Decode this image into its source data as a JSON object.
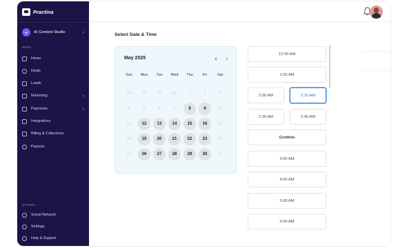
{
  "brand": {
    "name": "Practina"
  },
  "sidebar": {
    "studio": {
      "label": "AI Content Studio"
    },
    "menu_label": "MENU",
    "items": [
      {
        "label": "Home",
        "icon": "home-icon",
        "has_arrow": false
      },
      {
        "label": "Deals",
        "icon": "deals-icon",
        "has_arrow": false
      },
      {
        "label": "Leads",
        "icon": "funnel-icon",
        "has_arrow": false
      },
      {
        "label": "Marketing",
        "icon": "megaphone-icon",
        "has_arrow": true
      },
      {
        "label": "Payments",
        "icon": "card-icon",
        "has_arrow": true
      },
      {
        "label": "Integrations",
        "icon": "integrations-icon",
        "has_arrow": false
      },
      {
        "label": "Billing & Collections",
        "icon": "billing-icon",
        "has_arrow": false
      },
      {
        "label": "Payouts",
        "icon": "payouts-icon",
        "has_arrow": false
      }
    ],
    "others_label": "OTHERS",
    "others": [
      {
        "label": "Social Network",
        "icon": "link-icon"
      },
      {
        "label": "Settings",
        "icon": "gear-icon"
      },
      {
        "label": "Help & Support",
        "icon": "help-icon"
      }
    ]
  },
  "page": {
    "title": "Select Date & Time"
  },
  "calendar": {
    "month": "May 2025",
    "weekdays": [
      "Sun",
      "Mon",
      "Tue",
      "Wed",
      "Thu",
      "Fri",
      "Sat"
    ],
    "weeks": [
      [
        {
          "d": "28",
          "a": false
        },
        {
          "d": "29",
          "a": false
        },
        {
          "d": "30",
          "a": false
        },
        {
          "d": "31",
          "a": false
        },
        {
          "d": "1",
          "a": false
        },
        {
          "d": "2",
          "a": false
        },
        {
          "d": "3",
          "a": false
        }
      ],
      [
        {
          "d": "4",
          "a": false
        },
        {
          "d": "5",
          "a": false
        },
        {
          "d": "6",
          "a": false
        },
        {
          "d": "7",
          "a": false
        },
        {
          "d": "8",
          "a": true
        },
        {
          "d": "9",
          "a": true
        },
        {
          "d": "10",
          "a": false
        }
      ],
      [
        {
          "d": "11",
          "a": false
        },
        {
          "d": "12",
          "a": true
        },
        {
          "d": "13",
          "a": true
        },
        {
          "d": "14",
          "a": true
        },
        {
          "d": "15",
          "a": true
        },
        {
          "d": "16",
          "a": true
        },
        {
          "d": "17",
          "a": false
        }
      ],
      [
        {
          "d": "18",
          "a": false
        },
        {
          "d": "19",
          "a": true
        },
        {
          "d": "20",
          "a": true
        },
        {
          "d": "21",
          "a": true
        },
        {
          "d": "22",
          "a": true
        },
        {
          "d": "23",
          "a": true
        },
        {
          "d": "24",
          "a": false
        }
      ],
      [
        {
          "d": "25",
          "a": false
        },
        {
          "d": "26",
          "a": true
        },
        {
          "d": "27",
          "a": true
        },
        {
          "d": "28",
          "a": true
        },
        {
          "d": "29",
          "a": true
        },
        {
          "d": "30",
          "a": true
        },
        {
          "d": "1",
          "a": false
        }
      ]
    ]
  },
  "times": {
    "slot_1200": "12:00 AM",
    "slot_0100": "1:00 AM",
    "slot_0200": "2:00 AM",
    "slot_0215": "2:15 AM",
    "slot_0230": "2:30 AM",
    "slot_0245": "2:45 AM",
    "confirm": "Confirm",
    "slot_0300": "3:00 AM",
    "slot_0400": "4:00 AM",
    "slot_0500": "5:00 AM",
    "slot_0600": "6:00 AM"
  },
  "colors": {
    "sidebar": "#1b1446",
    "accent": "#3b86d6",
    "studio_icon": "#7a55f2"
  }
}
